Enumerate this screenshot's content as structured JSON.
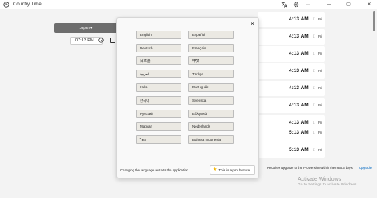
{
  "titlebar": {
    "app_title": "Country Time",
    "icons": [
      "app-clock-icon",
      "translate-icon",
      "settings-icon",
      "more-icon",
      "minimize-icon",
      "maximize-icon",
      "close-icon"
    ],
    "more_label": "···",
    "minimize_label": "—",
    "maximize_label": "▢",
    "close_label": "✕"
  },
  "left_pane": {
    "country": "Japan",
    "country_chevron": "▾",
    "time_value": "07:13 PM"
  },
  "times": [
    {
      "time": "4:13 AM",
      "day": "Fri"
    },
    {
      "time": "4:13 AM",
      "day": "Fri"
    },
    {
      "time": "4:13 AM",
      "day": "Fri"
    },
    {
      "time": "4:13 AM",
      "day": "Fri"
    },
    {
      "time": "4:13 AM",
      "day": "Fri"
    },
    {
      "time": "4:13 AM",
      "day": "Fri"
    },
    {
      "time": "4:13 AM",
      "day": "Fri"
    },
    {
      "time": "4:13 AM",
      "day": "Fri"
    },
    {
      "time": "5:13 AM",
      "day": "Fri"
    },
    {
      "time": "5:13 AM",
      "day": "Fri"
    }
  ],
  "pro_note": "Requires upgrade to the Pro version within the next 3 days.",
  "upgrade_label": "Upgrade",
  "watermark": {
    "title": "Activate Windows",
    "subtitle": "Go to Settings to activate Windows."
  },
  "dialog": {
    "close_label": "✕",
    "languages": [
      [
        "English",
        "Español"
      ],
      [
        "Deutsch",
        "Français"
      ],
      [
        "日本語",
        "中文"
      ],
      [
        "العربية",
        "Türkçe"
      ],
      [
        "Italia",
        "Português"
      ],
      [
        "한국어",
        "Svenska"
      ],
      [
        "Русский",
        "Ελληνικά"
      ],
      [
        "Magyar",
        "Nederlands"
      ],
      [
        "ไทย",
        "Bahasa Indonesia"
      ]
    ],
    "footer_note": "Changing the language restarts the application.",
    "pro_badge": "This is a pro feature.",
    "pro_star": "★"
  },
  "colors": {
    "accent": "#0067c0",
    "star": "#f2b400"
  }
}
